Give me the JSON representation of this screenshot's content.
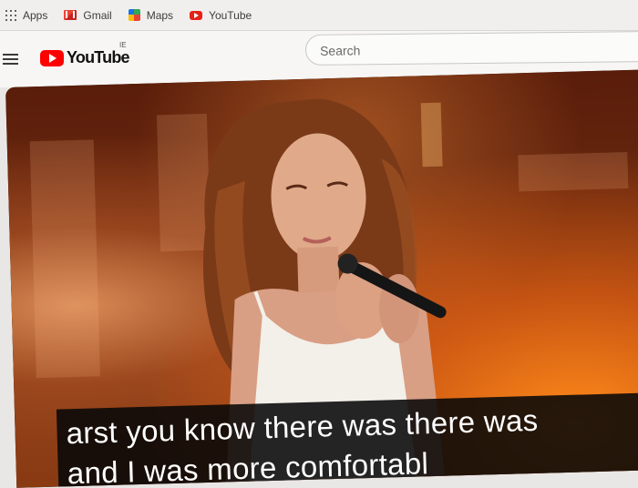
{
  "bookmarks": [
    {
      "label": "Apps",
      "icon": "apps-grid-icon"
    },
    {
      "label": "Gmail",
      "icon": "gmail-icon"
    },
    {
      "label": "Maps",
      "icon": "maps-icon"
    },
    {
      "label": "YouTube",
      "icon": "youtube-icon"
    }
  ],
  "masthead": {
    "logo_text": "YouTube",
    "country_code": "IE",
    "search_placeholder": "Search"
  },
  "video": {
    "caption_line1": "arst you know there was there was",
    "caption_line2": "and I was more comfortabl"
  },
  "colors": {
    "brand_red": "#ff0000",
    "caption_bg": "#080808"
  }
}
